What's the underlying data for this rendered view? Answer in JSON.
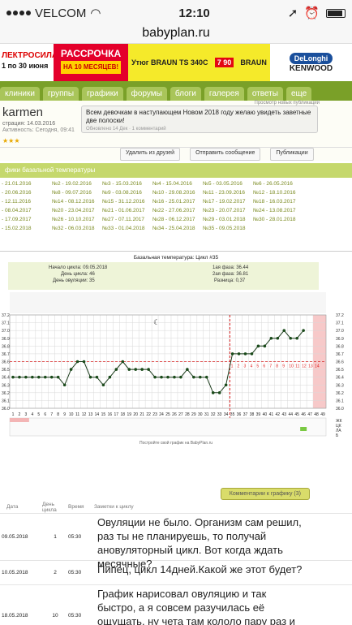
{
  "status_bar": {
    "carrier": "VELCOM",
    "time": "12:10"
  },
  "url_bar": {
    "url": "babyplan.ru"
  },
  "banner": {
    "ad1_brand": "ЛЕКТРОСИЛА",
    "ad1_sub": "1 по 30 июня",
    "ad2_line1": "РАССРОЧКА",
    "ad2_line2": "НА 10 МЕСЯЦЕВ!",
    "ad3_product": "Утюг BRAUN TS 340C",
    "ad3_price": "7 90",
    "ad3_brand": "BRAUN",
    "ad4_brand1": "DeLonghi",
    "ad4_brand2": "KENWOOD"
  },
  "nav": {
    "items": [
      "клиники",
      "группы",
      "графики",
      "форумы",
      "блоги",
      "галерея",
      "ответы",
      "еще"
    ]
  },
  "profile": {
    "name": "karmen",
    "registered": "страция: 14.03.2016",
    "activity": "Активность: Сегодня, 09:41",
    "recent_pubs": "Просмотр новых публикаций",
    "message": "Всем девочкам в наступающем Новом 2018 году желаю увидеть заветные две полоски!",
    "message_meta": "Обновлено 14 Дек · 1 комментарий"
  },
  "buttons": {
    "remove_friend": "Удалить из друзей",
    "send_message": "Отправить сообщение",
    "publications": "Публикации"
  },
  "bt_header": "фики базальной температуры",
  "cycles": [
    [
      "- 21.01.2016",
      "№2 - 19.02.2016",
      "№3 - 15.03.2016",
      "№4 - 15.04.2016",
      "№5 - 03.05.2016",
      "№6 - 26.05.2016"
    ],
    [
      "- 20.06.2016",
      "№8 - 09.07.2016",
      "№9 - 03.08.2016",
      "№10 - 29.08.2016",
      "№11 - 23.09.2016",
      "№12 - 18.10.2016"
    ],
    [
      "- 12.11.2016",
      "№14 - 08.12.2016",
      "№15 - 31.12.2016",
      "№16 - 25.01.2017",
      "№17 - 19.02.2017",
      "№18 - 16.03.2017"
    ],
    [
      "- 08.04.2017",
      "№20 - 23.04.2017",
      "№21 - 01.06.2017",
      "№22 - 27.06.2017",
      "№23 - 20.07.2017",
      "№24 - 13.08.2017"
    ],
    [
      "- 17.09.2017",
      "№26 - 10.10.2017",
      "№27 - 07.11.2017",
      "№28 - 06.12.2017",
      "№29 - 03.01.2018",
      "№30 - 28.01.2018"
    ],
    [
      "- 15.02.2018",
      "№32 - 06.03.2018",
      "№33 - 01.04.2018",
      "№34 - 25.04.2018",
      "№35 - 09.05.2018",
      ""
    ]
  ],
  "chart_info": {
    "title": "Базальная температура: Цикл #35",
    "start_label": "Начало цикла: 09.05.2018",
    "day_label": "День цикла: 46",
    "ovulation_label": "День овуляции: 35",
    "phase1": "1ая фаза: 36.44",
    "phase2": "2ая фаза: 36.81",
    "diff": "Разница: 0,37",
    "footer": "Постройте свой график на BabyPlan.ru",
    "comments_btn": "Комментарии к графику (3)"
  },
  "chart_data": {
    "type": "line",
    "title": "Базальная температура: Цикл #35",
    "x": [
      1,
      2,
      3,
      4,
      5,
      6,
      7,
      8,
      9,
      10,
      11,
      12,
      13,
      14,
      15,
      16,
      17,
      18,
      19,
      20,
      21,
      22,
      23,
      24,
      25,
      26,
      27,
      28,
      29,
      30,
      31,
      32,
      33,
      34,
      35,
      36,
      37,
      38,
      39,
      40,
      41,
      42,
      43,
      44,
      45,
      46
    ],
    "values": [
      36.4,
      36.4,
      36.4,
      36.4,
      36.4,
      36.4,
      36.4,
      36.4,
      36.3,
      36.5,
      36.6,
      36.6,
      36.4,
      36.4,
      36.3,
      36.4,
      36.5,
      36.6,
      36.5,
      36.5,
      36.5,
      36.5,
      36.4,
      36.4,
      36.4,
      36.4,
      36.4,
      36.5,
      36.4,
      36.4,
      36.4,
      36.2,
      36.2,
      36.3,
      36.7,
      36.7,
      36.7,
      36.7,
      36.8,
      36.8,
      36.9,
      36.9,
      37.0,
      36.9,
      36.9,
      37.0
    ],
    "ylim": [
      36.0,
      37.2
    ],
    "yticks": [
      "36.0",
      "36.1",
      "36.2",
      "36.3",
      "36.4",
      "36.5",
      "36.6",
      "36.7",
      "36.8",
      "36.9",
      "37.0",
      "37.1",
      "37.2"
    ],
    "coverline": 36.6,
    "ovulation_day": 35,
    "phase2_numbers": [
      "1",
      "2",
      "3",
      "4",
      "5",
      "6",
      "7",
      "8",
      "9",
      "10",
      "11",
      "12",
      "13",
      "14"
    ],
    "bottom_row_labels": [
      "ЖК",
      "ЦК",
      "ЛА",
      "Б"
    ]
  },
  "comments_table": {
    "headers": {
      "date": "Дата",
      "day": "День цикла",
      "time": "Время",
      "notes": "Заметки к циклу"
    },
    "rows": [
      {
        "date": "09.05.2018",
        "day": "1",
        "time": "05:30",
        "note": "Овуляции не было. Организм сам решил, раз ты не планируешь, то получай ановуляторный цикл. Вот когда ждать месячные?"
      },
      {
        "date": "10.05.2018",
        "day": "2",
        "time": "05:30",
        "note": "Пипец, цикл 14дней.Какой же этот будет?"
      },
      {
        "date": "18.05.2018",
        "day": "10",
        "time": "05:30",
        "note": "График нарисовал овуляцию и так быстро, а я совсем разучилась её ощущать, ну чета там кололо пару раз и пекло, но я не обратила внимание. С па не попала, а если и попала, то все равно не попала, вообще уже все равно"
      }
    ]
  }
}
